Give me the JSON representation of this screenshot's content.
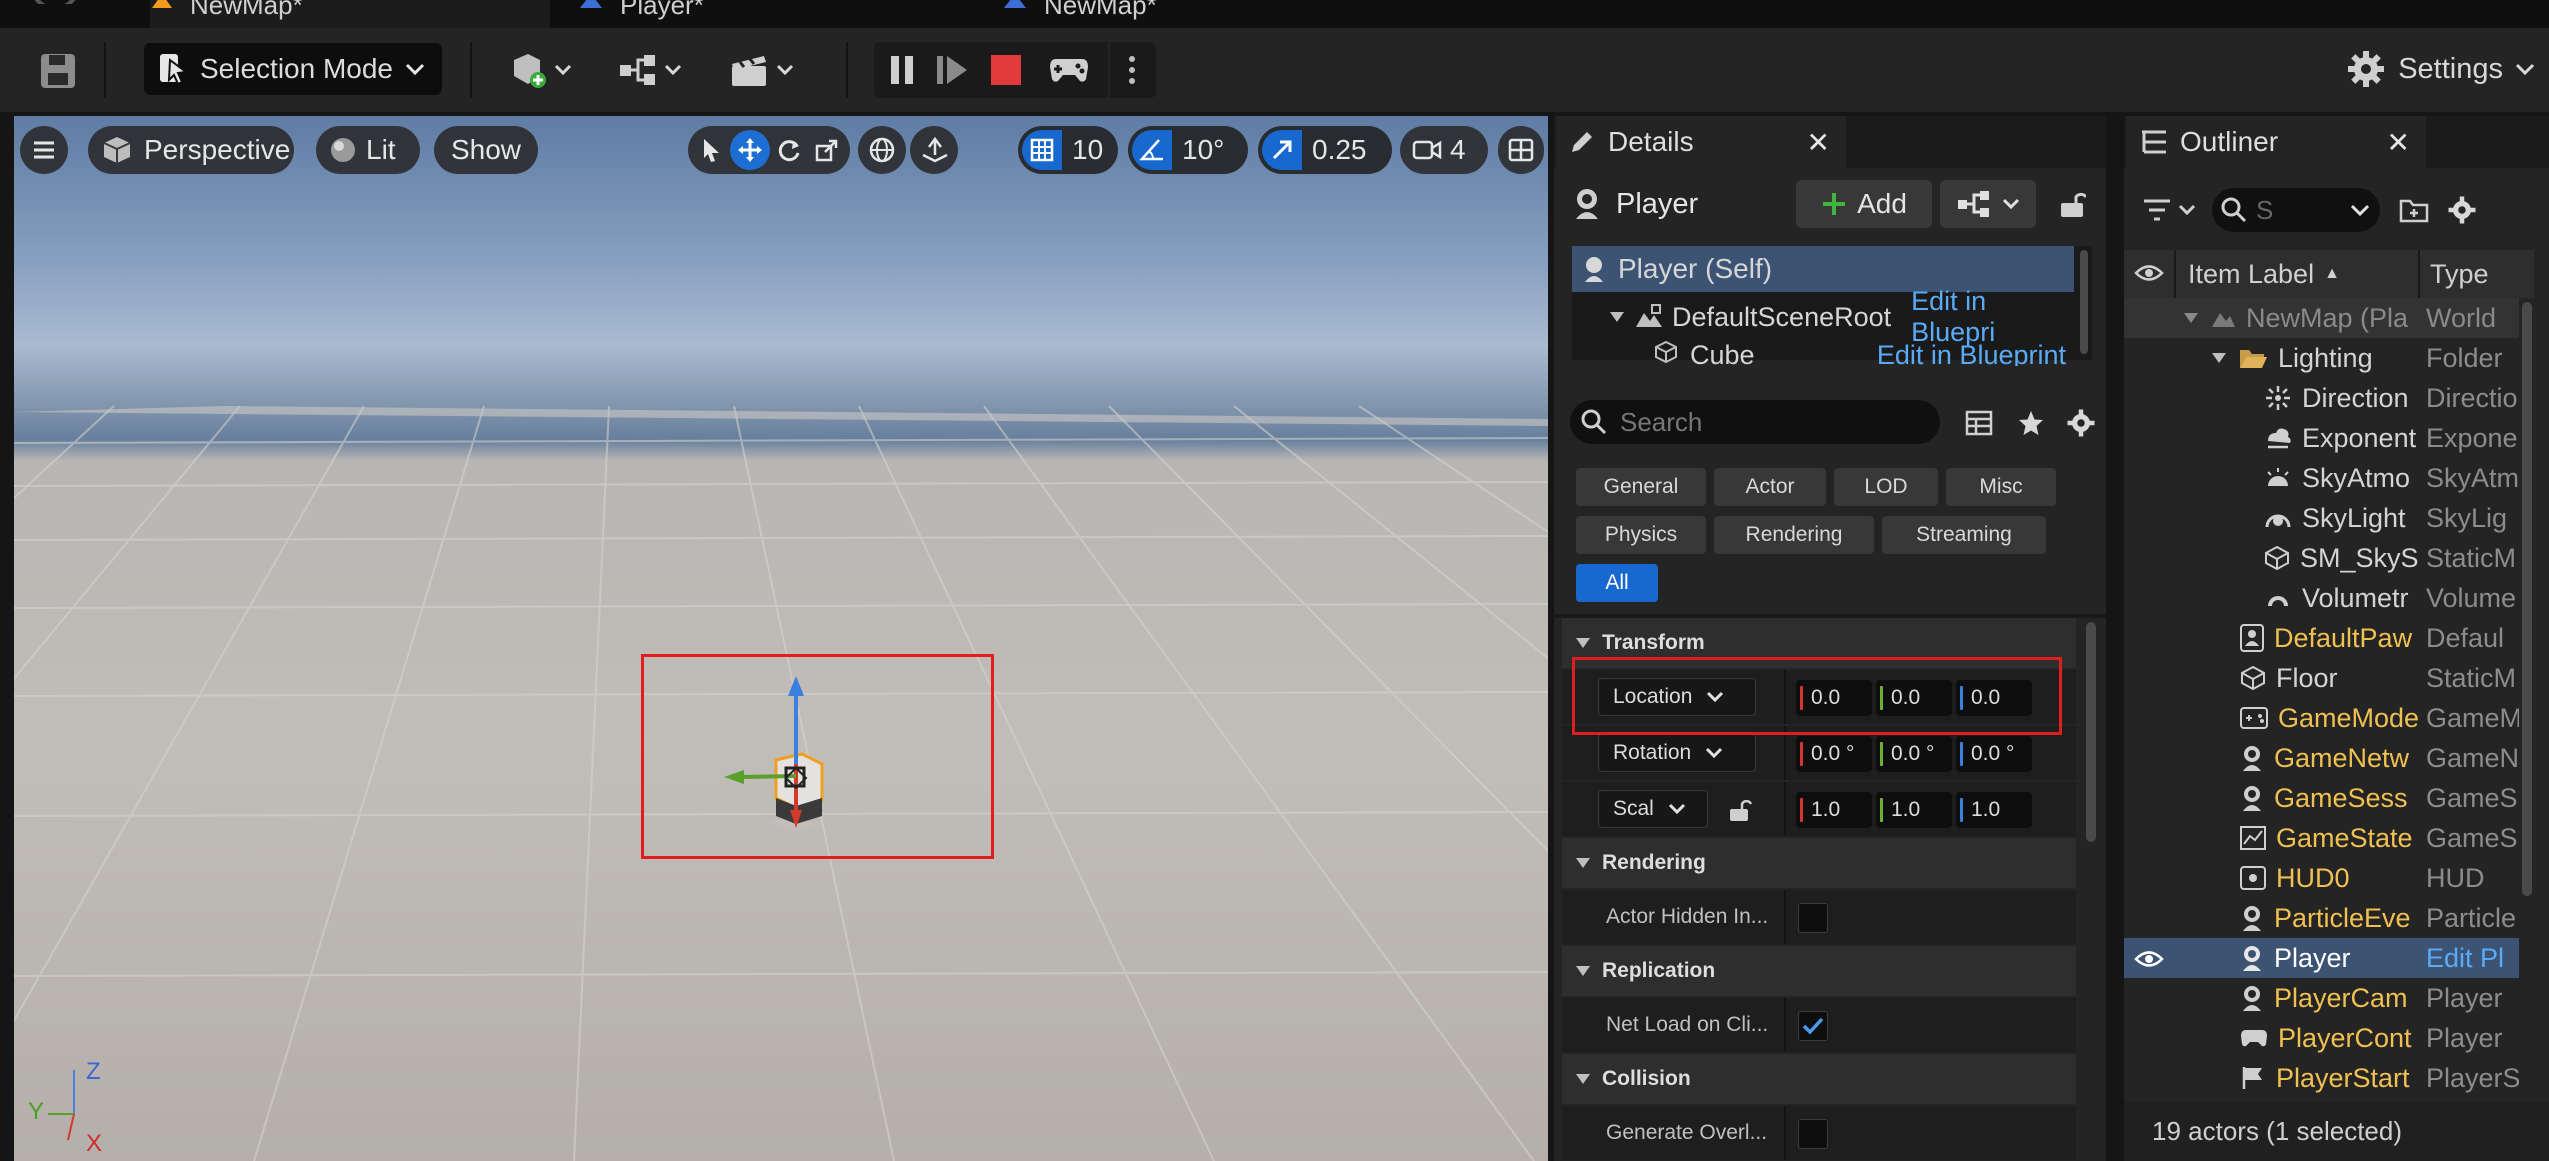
{
  "tabs": [
    {
      "label": "NewMap*",
      "icon": "level-icon",
      "color": "#f29b1c"
    },
    {
      "label": "Player*",
      "icon": "blueprint-icon",
      "color": "#3b6fd6"
    },
    {
      "label": "NewMap*",
      "icon": "blueprint-icon",
      "color": "#3b6fd6"
    }
  ],
  "toolbar": {
    "selection_mode": "Selection Mode",
    "settings": "Settings"
  },
  "viewport": {
    "perspective": "Perspective",
    "lit": "Lit",
    "show": "Show",
    "grid_snap": "10",
    "rotation_snap": "10°",
    "scale_snap": "0.25",
    "camera_speed": "4",
    "axes": {
      "z": "Z",
      "y": "Y",
      "x": "X"
    }
  },
  "details": {
    "tab_title": "Details",
    "actor_name": "Player",
    "add_label": "Add",
    "components": [
      {
        "label": "Player (Self)",
        "link": ""
      },
      {
        "label": "DefaultSceneRoot",
        "link": "Edit in Bluepri"
      },
      {
        "label": "Cube",
        "link": "Edit in Blueprint"
      }
    ],
    "search_placeholder": "Search",
    "categories": [
      "General",
      "Actor",
      "LOD",
      "Misc",
      "Physics",
      "Rendering",
      "Streaming",
      "All"
    ],
    "transform": {
      "title": "Transform",
      "location_label": "Location",
      "location": [
        "0.0",
        "0.0",
        "0.0"
      ],
      "rotation_label": "Rotation",
      "rotation": [
        "0.0 °",
        "0.0 °",
        "0.0 °"
      ],
      "scale_label": "Scal",
      "scale": [
        "1.0",
        "1.0",
        "1.0"
      ]
    },
    "rendering": {
      "title": "Rendering",
      "prop": "Actor Hidden In..."
    },
    "replication": {
      "title": "Replication",
      "prop": "Net Load on Cli..."
    },
    "collision": {
      "title": "Collision",
      "prop": "Generate Overl..."
    }
  },
  "outliner": {
    "tab_title": "Outliner",
    "search_placeholder": "S",
    "col_label": "Item Label",
    "col_sort": "▲",
    "col_type": "Type",
    "rows": [
      {
        "name": "NewMap (Pla",
        "type": "World"
      },
      {
        "name": "Lighting",
        "type": "Folder"
      },
      {
        "name": "Direction",
        "type": "Directio"
      },
      {
        "name": "Exponent",
        "type": "Expone"
      },
      {
        "name": "SkyAtmo",
        "type": "SkyAtm"
      },
      {
        "name": "SkyLight",
        "type": "SkyLig"
      },
      {
        "name": "SM_SkyS",
        "type": "StaticM"
      },
      {
        "name": "Volumetr",
        "type": "Volume"
      },
      {
        "name": "DefaultPaw",
        "type": "Defaul"
      },
      {
        "name": "Floor",
        "type": "StaticM"
      },
      {
        "name": "GameMode",
        "type": "GameM"
      },
      {
        "name": "GameNetw",
        "type": "GameN"
      },
      {
        "name": "GameSess",
        "type": "GameS"
      },
      {
        "name": "GameState",
        "type": "GameS"
      },
      {
        "name": "HUD0",
        "type": "HUD"
      },
      {
        "name": "ParticleEve",
        "type": "Particle"
      },
      {
        "name": "Player",
        "type": "Edit Pl"
      },
      {
        "name": "PlayerCam",
        "type": "Player"
      },
      {
        "name": "PlayerCont",
        "type": "Player"
      },
      {
        "name": "PlayerStart",
        "type": "PlayerS"
      }
    ],
    "status": "19 actors (1 selected)"
  }
}
